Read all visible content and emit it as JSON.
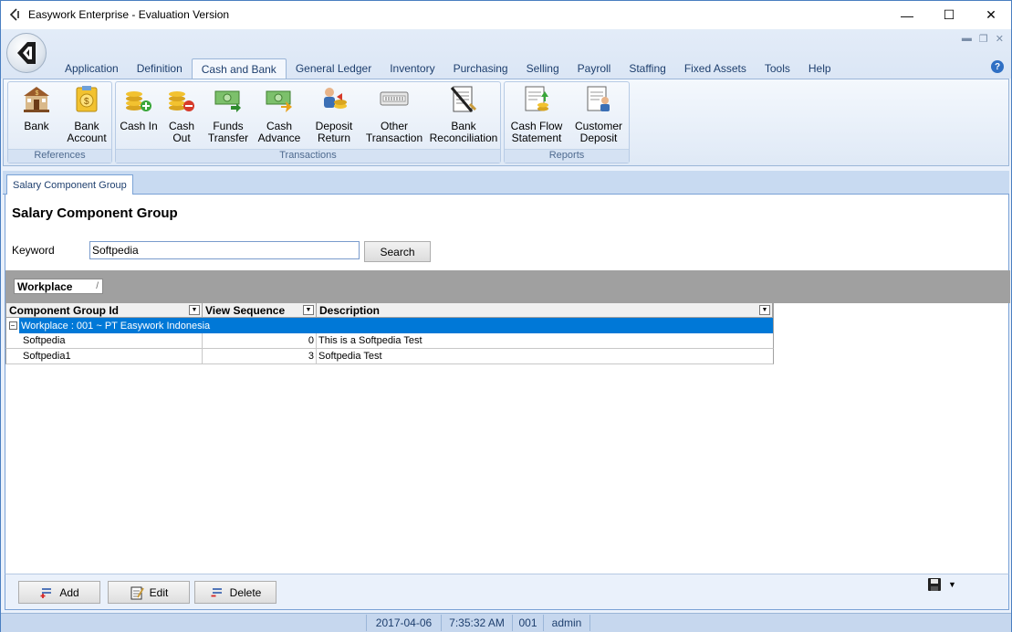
{
  "window": {
    "title": "Easywork Enterprise - Evaluation Version",
    "min_glyph": "—",
    "max_glyph": "☐",
    "close_glyph": "✕",
    "mdi_min": "▬",
    "mdi_restore": "❐",
    "mdi_close": "✕"
  },
  "ribbon": {
    "tabs": [
      "Application",
      "Definition",
      "Cash and Bank",
      "General Ledger",
      "Inventory",
      "Purchasing",
      "Selling",
      "Payroll",
      "Staffing",
      "Fixed Assets",
      "Tools",
      "Help"
    ],
    "active_tab": "Cash and Bank",
    "help_glyph": "?",
    "groups": {
      "references": {
        "label": "References",
        "buttons": [
          {
            "label_1": "Bank",
            "label_2": "",
            "icon": "bank-icon"
          },
          {
            "label_1": "Bank",
            "label_2": "Account",
            "icon": "bank-account-icon"
          }
        ]
      },
      "transactions": {
        "label": "Transactions",
        "buttons": [
          {
            "label_1": "Cash In",
            "label_2": "",
            "icon": "cash-in-icon"
          },
          {
            "label_1": "Cash",
            "label_2": "Out",
            "icon": "cash-out-icon"
          },
          {
            "label_1": "Funds",
            "label_2": "Transfer",
            "icon": "funds-transfer-icon"
          },
          {
            "label_1": "Cash",
            "label_2": "Advance",
            "icon": "cash-advance-icon"
          },
          {
            "label_1": "Deposit",
            "label_2": "Return",
            "icon": "deposit-return-icon"
          },
          {
            "label_1": "Other",
            "label_2": "Transaction",
            "icon": "other-transaction-icon"
          },
          {
            "label_1": "Bank",
            "label_2": "Reconciliation",
            "icon": "bank-reconciliation-icon"
          }
        ]
      },
      "reports": {
        "label": "Reports",
        "buttons": [
          {
            "label_1": "Cash Flow",
            "label_2": "Statement",
            "icon": "cash-flow-statement-icon"
          },
          {
            "label_1": "Customer",
            "label_2": "Deposit",
            "icon": "customer-deposit-icon"
          }
        ]
      }
    }
  },
  "document_tab": "Salary Component Group",
  "page": {
    "title": "Salary Component Group",
    "keyword_label": "Keyword",
    "keyword_value": "Softpedia",
    "search_label": "Search",
    "group_by_chip": "Workplace",
    "group_by_sort": "/"
  },
  "grid": {
    "columns": [
      "Component Group Id",
      "View Sequence",
      "Description"
    ],
    "dropdown_glyph": "▼",
    "expander_glyph": "−",
    "group_row": "Workplace : 001 ~ PT Easywork Indonesia",
    "rows": [
      {
        "id": "Softpedia",
        "seq": "0",
        "desc": "This is a Softpedia Test"
      },
      {
        "id": "Softpedia1",
        "seq": "3",
        "desc": "Softpedia Test"
      }
    ]
  },
  "actions": {
    "add": "Add",
    "edit": "Edit",
    "delete": "Delete",
    "save_dropdown_glyph": "▼"
  },
  "status": {
    "date": "2017-04-06",
    "time": "7:35:32 AM",
    "code": "001",
    "user": "admin"
  }
}
